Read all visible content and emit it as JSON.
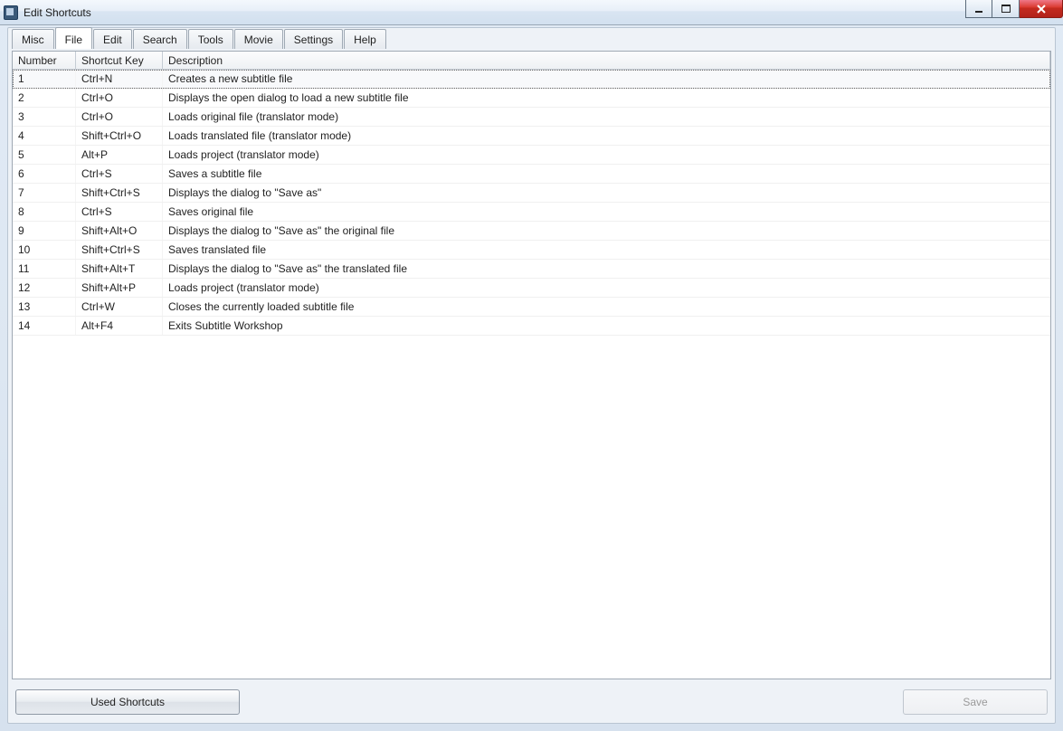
{
  "window": {
    "title": "Edit Shortcuts"
  },
  "tabs": {
    "items": [
      {
        "label": "Misc"
      },
      {
        "label": "File"
      },
      {
        "label": "Edit"
      },
      {
        "label": "Search"
      },
      {
        "label": "Tools"
      },
      {
        "label": "Movie"
      },
      {
        "label": "Settings"
      },
      {
        "label": "Help"
      }
    ],
    "active_index": 1
  },
  "grid": {
    "headers": {
      "number": "Number",
      "shortcut": "Shortcut Key",
      "description": "Description"
    },
    "rows": [
      {
        "number": "1",
        "shortcut": "Ctrl+N",
        "description": "Creates a new subtitle file"
      },
      {
        "number": "2",
        "shortcut": "Ctrl+O",
        "description": "Displays the open dialog to load a new subtitle file"
      },
      {
        "number": "3",
        "shortcut": "Ctrl+O",
        "description": "Loads original file (translator mode)"
      },
      {
        "number": "4",
        "shortcut": "Shift+Ctrl+O",
        "description": "Loads translated file (translator mode)"
      },
      {
        "number": "5",
        "shortcut": "Alt+P",
        "description": "Loads project (translator mode)"
      },
      {
        "number": "6",
        "shortcut": "Ctrl+S",
        "description": "Saves a subtitle file"
      },
      {
        "number": "7",
        "shortcut": "Shift+Ctrl+S",
        "description": "Displays the dialog to \"Save as\""
      },
      {
        "number": "8",
        "shortcut": "Ctrl+S",
        "description": "Saves original file"
      },
      {
        "number": "9",
        "shortcut": "Shift+Alt+O",
        "description": "Displays the dialog to \"Save as\" the original file"
      },
      {
        "number": "10",
        "shortcut": "Shift+Ctrl+S",
        "description": "Saves translated file"
      },
      {
        "number": "11",
        "shortcut": "Shift+Alt+T",
        "description": "Displays the dialog to \"Save as\" the translated file"
      },
      {
        "number": "12",
        "shortcut": "Shift+Alt+P",
        "description": "Loads project (translator mode)"
      },
      {
        "number": "13",
        "shortcut": "Ctrl+W",
        "description": "Closes the currently loaded subtitle file"
      },
      {
        "number": "14",
        "shortcut": "Alt+F4",
        "description": "Exits Subtitle Workshop"
      }
    ],
    "selected_index": 0
  },
  "footer": {
    "used_shortcuts": "Used Shortcuts",
    "save": "Save"
  }
}
